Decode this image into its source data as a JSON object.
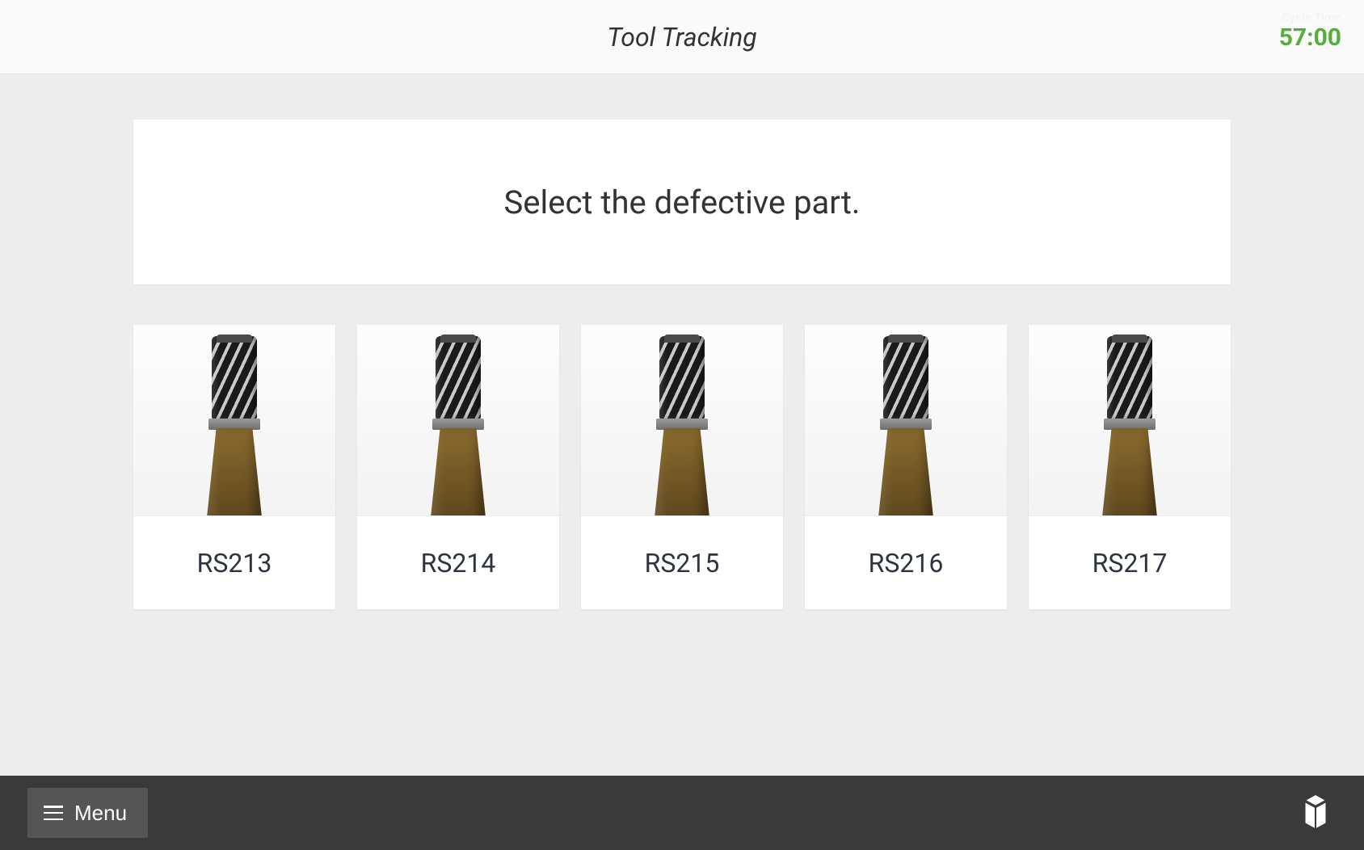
{
  "header": {
    "title": "Tool Tracking",
    "cycle_label": "Cycle Time",
    "cycle_time": "57:00"
  },
  "prompt": {
    "text": "Select the defective part."
  },
  "parts": [
    {
      "id": "RS213"
    },
    {
      "id": "RS214"
    },
    {
      "id": "RS215"
    },
    {
      "id": "RS216"
    },
    {
      "id": "RS217"
    }
  ],
  "footer": {
    "menu_label": "Menu"
  }
}
